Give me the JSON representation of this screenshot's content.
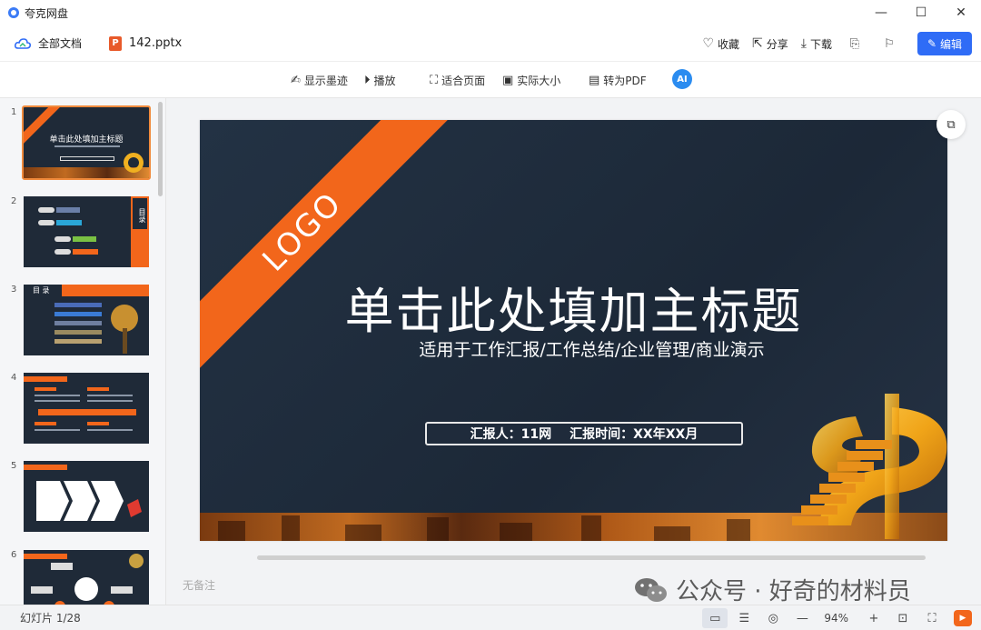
{
  "app": {
    "title": "夸克网盘"
  },
  "window": {
    "minimize": "—",
    "maximize": "☐",
    "close": "✕"
  },
  "header": {
    "breadcrumb": "全部文档",
    "file_name": "142.pptx",
    "file_badge": "P",
    "favorite": "收藏",
    "share": "分享",
    "download": "下载",
    "edit": "编辑"
  },
  "toolbar": {
    "show_ink": "显示墨迹",
    "play": "播放",
    "fit_page": "适合页面",
    "actual_size": "实际大小",
    "to_pdf": "转为PDF",
    "ai_badge": "AI"
  },
  "thumbnails": [
    {
      "num": "1"
    },
    {
      "num": "2"
    },
    {
      "num": "3"
    },
    {
      "num": "4"
    },
    {
      "num": "5"
    },
    {
      "num": "6"
    }
  ],
  "thumb_texts": {
    "t1_title": "单击此处填加主标题",
    "t2_side": "目录",
    "t3_head": "目 录"
  },
  "slide": {
    "logo": "LOGO",
    "title": "单击此处填加主标题",
    "subtitle": "适用于工作汇报/工作总结/企业管理/商业演示",
    "reporter": "汇报人：11网",
    "report_time": "汇报时间：XX年XX月"
  },
  "notes": "无备注",
  "watermark": "公众号 · 好奇的材料员",
  "status": {
    "slide_count": "幻灯片 1/28",
    "zoom": "94%"
  },
  "colors": {
    "accent": "#2f6cf6",
    "orange": "#f2661b",
    "slide_bg": "#1f2a38"
  }
}
